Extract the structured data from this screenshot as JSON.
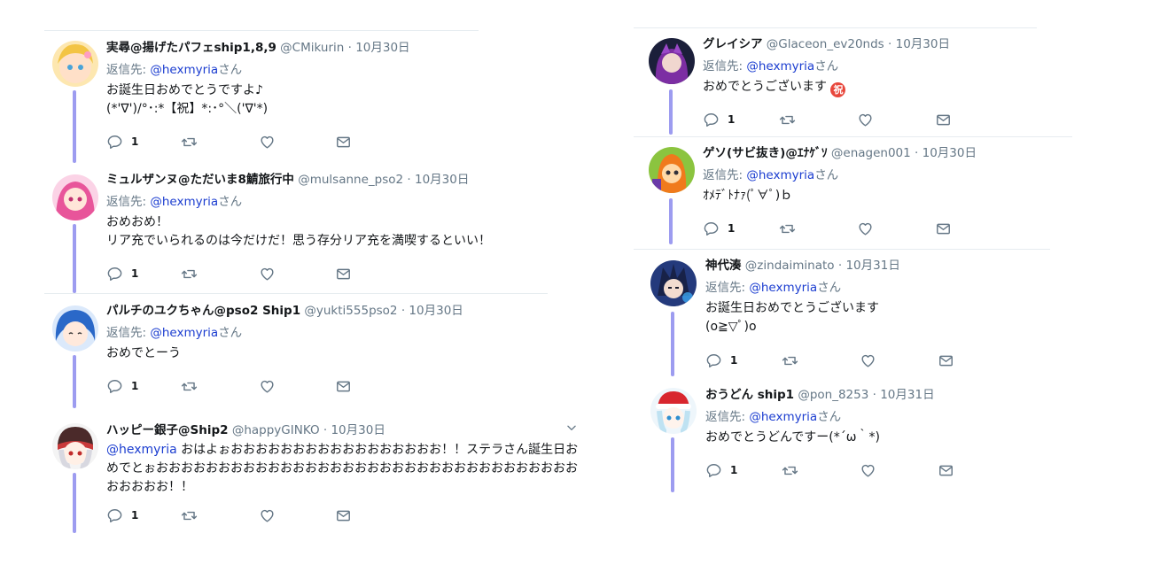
{
  "separator": "·",
  "reply_prefix": "返信先:",
  "reply_suffix": "さん",
  "icons": {
    "reply": "reply-icon",
    "retweet": "retweet-icon",
    "like": "heart-icon",
    "dm": "envelope-icon",
    "more": "chevron-down-icon",
    "emoji": "iwai-emoji-icon"
  },
  "colors": {
    "thread_line": "#9d9cf0",
    "link": "#1b3dd0",
    "muted": "#657786"
  },
  "left_column": [
    {
      "name": "実尋@揚げたパフェship1,8,9",
      "handle": "@CMikurin",
      "time": "10月30日",
      "reply_handle": "@hexmyria",
      "text": "お誕生日おめでとうですよ♪\n(*'∇')/°･:*【祝】*:･°＼('∇'*)",
      "reply_count": "1"
    },
    {
      "name": "ミュルザンヌ@ただいま8鯖旅行中",
      "handle": "@mulsanne_pso2",
      "time": "10月30日",
      "reply_handle": "@hexmyria",
      "text": "おめおめ！\nリア充でいられるのは今だけだ！思う存分リア充を満喫するといい！",
      "reply_count": "1"
    },
    {
      "name": "パルチのユクちゃん@pso2 Ship1",
      "handle": "@yukti555pso2",
      "time": "10月30日",
      "reply_handle": "@hexmyria",
      "text": "おめでとーう",
      "reply_count": "1"
    },
    {
      "name": "ハッピー銀子@Ship2",
      "handle": "@happyGINKO",
      "time": "10月30日",
      "mention": "@hexmyria",
      "text": " おはよぉおおおおおおおおおおおおおおおおお！！ステラさん誕生日おめでとぉおおおおおおおおおおおおおおおおおおおおおおおおおおおおおおおおおおおおおおお！！",
      "reply_count": "1"
    }
  ],
  "right_column": [
    {
      "name": "グレイシア",
      "handle": "@Glaceon_ev20nds",
      "time": "10月30日",
      "reply_handle": "@hexmyria",
      "text": "おめでとうございます",
      "reply_count": "1"
    },
    {
      "name": "ゲソ(サビ抜き)@ｴﾅｹﾞｿ",
      "handle": "@enagen001",
      "time": "10月30日",
      "reply_handle": "@hexmyria",
      "text": "ｵﾒﾃﾞﾄﾅｧ(ﾟ∀ﾟ)ｂ",
      "reply_count": "1"
    },
    {
      "name": "神代湊",
      "handle": "@zindaiminato",
      "time": "10月31日",
      "reply_handle": "@hexmyria",
      "text": "お誕生日おめでとうございます\n(o≧▽ﾟ)o",
      "reply_count": "1"
    },
    {
      "name": "おうどん ship1",
      "handle": "@pon_8253",
      "time": "10月31日",
      "reply_handle": "@hexmyria",
      "text": "おめでとうどんですー(*´ω｀*)",
      "reply_count": "1"
    }
  ]
}
